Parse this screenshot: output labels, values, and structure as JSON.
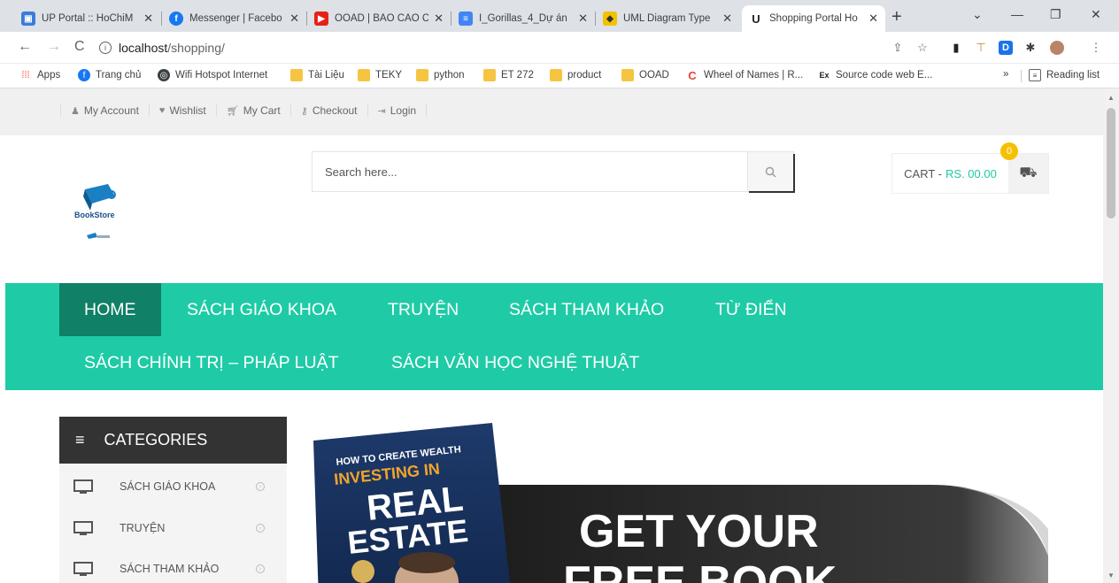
{
  "browser": {
    "tabs": [
      {
        "title": "UP Portal :: HoChiM",
        "icon": "portal-icon",
        "color": "#3b7dd8"
      },
      {
        "title": "Messenger | Facebo",
        "icon": "messenger-icon",
        "color": "#1877f2"
      },
      {
        "title": "OOAD | BÁO CÁO C",
        "icon": "youtube-icon",
        "color": "#e62117"
      },
      {
        "title": "I_Gorillas_4_Dự án",
        "icon": "docs-icon",
        "color": "#4285f4"
      },
      {
        "title": "UML Diagram Type",
        "icon": "uml-icon",
        "color": "#555555"
      },
      {
        "title": "Shopping Portal Ho",
        "icon": "shop-icon",
        "color": "#222222"
      }
    ],
    "url_host": "localhost",
    "url_path": "/shopping/",
    "bookmarks": [
      {
        "label": "Apps",
        "icon": "apps-icon"
      },
      {
        "label": "Trang chủ",
        "icon": "facebook-icon"
      },
      {
        "label": "Wifi Hotspot Internet",
        "icon": "globe-icon"
      },
      {
        "label": "Tài Liệu",
        "icon": "folder-icon"
      },
      {
        "label": "TEKY",
        "icon": "folder-icon"
      },
      {
        "label": "python",
        "icon": "folder-icon"
      },
      {
        "label": "ET 272",
        "icon": "folder-icon"
      },
      {
        "label": "product",
        "icon": "folder-icon"
      },
      {
        "label": "OOAD",
        "icon": "folder-icon"
      },
      {
        "label": "Wheel of Names | R...",
        "icon": "wheel-icon"
      },
      {
        "label": "Source code web E...",
        "icon": "ex-icon"
      }
    ],
    "more": "»",
    "reading_list": "Reading list"
  },
  "site": {
    "top_links": [
      {
        "label": "My Account",
        "icon": "user-icon"
      },
      {
        "label": "Wishlist",
        "icon": "heart-icon"
      },
      {
        "label": "My Cart",
        "icon": "cart-icon"
      },
      {
        "label": "Checkout",
        "icon": "key-icon"
      },
      {
        "label": "Login",
        "icon": "login-icon"
      }
    ],
    "logo_text": "BookStore",
    "search_placeholder": "Search here...",
    "cart_label": "CART - ",
    "cart_value": "RS. 00.00",
    "cart_count": "0",
    "nav": [
      {
        "label": "HOME",
        "active": true
      },
      {
        "label": "SÁCH GIÁO KHOA"
      },
      {
        "label": "TRUYỆN"
      },
      {
        "label": "SÁCH THAM KHẢO"
      },
      {
        "label": "TỪ ĐIỂN"
      },
      {
        "label": "SÁCH CHÍNH TRỊ – PHÁP LUẬT"
      },
      {
        "label": "SÁCH VĂN HỌC NGHỆ THUẬT"
      }
    ],
    "categories_title": "CATEGORIES",
    "categories": [
      "SÁCH GIÁO KHOA",
      "TRUYỆN",
      "SÁCH THAM KHẢO"
    ],
    "banner": {
      "book_line1": "HOW TO CREATE WEALTH",
      "book_line2": "INVESTING IN",
      "book_line3": "REAL",
      "book_line4": "ESTATE",
      "headline1": "GET YOUR",
      "headline2": "FREE BOOK"
    },
    "colors": {
      "accent": "#1ecba6",
      "accent_dark": "#108066",
      "badge": "#f5c000"
    }
  }
}
